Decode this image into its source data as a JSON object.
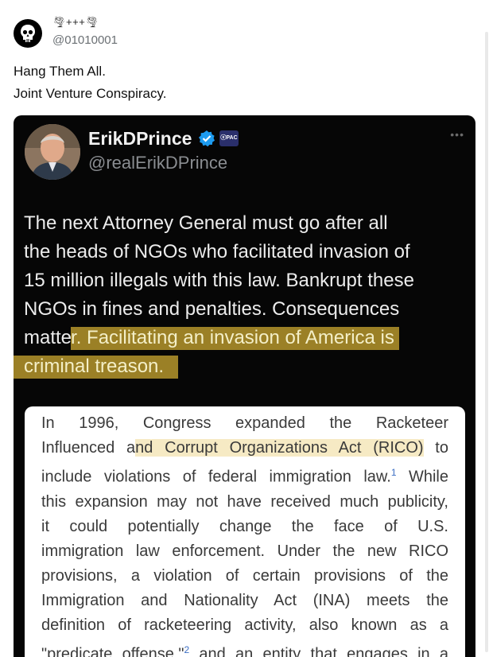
{
  "post": {
    "display_name": "🌪+++🌪",
    "handle": "@01010001",
    "lines": [
      "Hang Them All.",
      "Joint Venture Conspiracy."
    ]
  },
  "embed": {
    "name": "ErikDPrince",
    "handle": "@realErikDPrince",
    "badge_text": "ⓧPAC",
    "more": "•••",
    "lines": [
      "The next Attorney General must  go after all",
      "the heads of NGOs who facilitated invasion of",
      "15 million illegals with this law. Bankrupt these",
      "NGOs in fines and penalties. Consequences"
    ],
    "line5_a": "matte",
    "line5_b": "r. Facilitating an invasion of America is",
    "line6": "criminal treason."
  },
  "document": {
    "l1": "In 1996, Congress expanded the Racketeer",
    "l2_a": "Influenced a",
    "l2_b": "nd Corrupt Organizations Act (RICO)",
    "l2_c": " to",
    "l3_a": "include violations of federal immigration law.",
    "l3_sup": "1",
    "l3_b": " While",
    "l4": "this expansion may not have received much publicity,",
    "l5": "it could potentially change the face of U.S.",
    "l6": "immigration law enforcement. Under the new RICO",
    "l7": "provisions, a violation of certain provisions of the",
    "l8": "Immigration and Nationality Act (INA) meets the",
    "l9": "definition of racketeering activity, also known as a",
    "l10_a": "\"predicate offense,\"",
    "l10_sup": "2",
    "l10_b": " and an entity that engages in a"
  },
  "colors": {
    "highlight": "#cdaa32",
    "verified": "#1d9bf0",
    "embed_bg": "#060606"
  }
}
